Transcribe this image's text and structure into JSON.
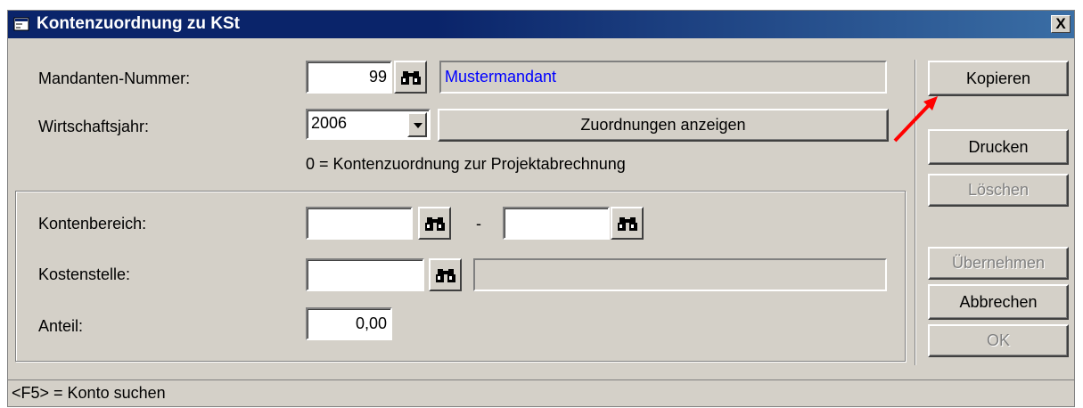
{
  "window": {
    "title": "Kontenzuordnung zu KSt",
    "close_label": "X"
  },
  "form": {
    "mandant_label": "Mandanten-Nummer:",
    "mandant_value": "99",
    "mandant_name": "Mustermandant",
    "wj_label": "Wirtschaftsjahr:",
    "wj_value": "2006",
    "show_button": "Zuordnungen anzeigen",
    "info_text": "0 = Kontenzuordnung zur Projektabrechnung",
    "kontenbereich_label": "Kontenbereich:",
    "kontenbereich_from": "",
    "kontenbereich_sep": "-",
    "kontenbereich_to": "",
    "kostenstelle_label": "Kostenstelle:",
    "kostenstelle_value": "",
    "kostenstelle_name": "",
    "anteil_label": "Anteil:",
    "anteil_value": "0,00"
  },
  "buttons": {
    "kopieren": "Kopieren",
    "drucken": "Drucken",
    "loeschen": "Löschen",
    "uebernehmen": "Übernehmen",
    "abbrechen": "Abbrechen",
    "ok": "OK"
  },
  "status": {
    "text": "<F5> = Konto suchen"
  },
  "colors": {
    "title_bar": "#0a246a",
    "mandant_name_text": "#0000ff",
    "annotation_arrow": "#ff0000"
  },
  "icons": {
    "app": "window-app-icon",
    "search": "binoculars-icon"
  }
}
